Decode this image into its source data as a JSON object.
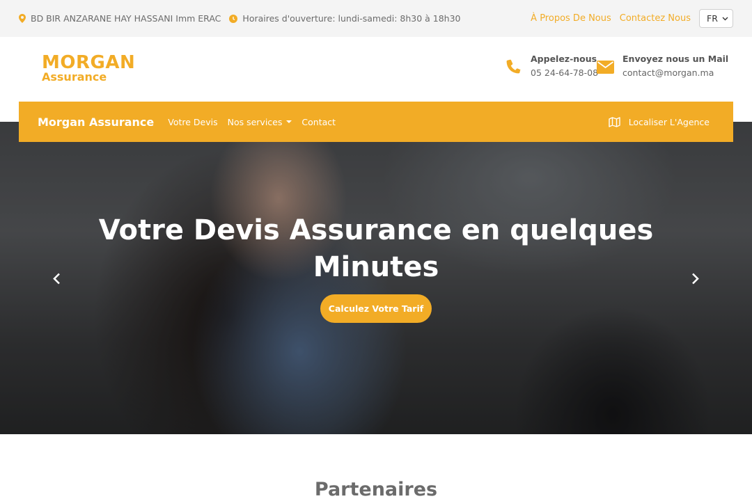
{
  "topbar": {
    "address": "BD BIR ANZARANE HAY HASSANI Imm ERAC",
    "hours": "Horaires d'ouverture: lundi-samedi: 8h30 à 18h30",
    "about_link": "À Propos De Nous",
    "contact_link": "Contactez Nous",
    "language": "FR"
  },
  "header": {
    "logo_line1": "MORGAN",
    "logo_line2": "Assurance",
    "phone_title": "Appelez-nous",
    "phone_value": "05 24-64-78-08",
    "mail_title": "Envoyez nous un Mail",
    "mail_value": "contact@morgan.ma"
  },
  "nav": {
    "brand": "Morgan Assurance",
    "items": [
      "Votre Devis",
      "Nos services",
      "Contact"
    ],
    "locate": "Localiser L'Agence"
  },
  "hero": {
    "title_line1": "Votre Devis Assurance en quelques",
    "title_line2": "Minutes",
    "cta": "Calculez Votre Tarif"
  },
  "partners": {
    "title": "Partenaires"
  },
  "colors": {
    "accent": "#f2ac26",
    "topbar_bg": "#f4f4f4"
  },
  "icons": [
    "map-marker-icon",
    "clock-icon",
    "phone-icon",
    "envelope-icon",
    "map-icon",
    "chevron-left-icon",
    "chevron-right-icon"
  ]
}
